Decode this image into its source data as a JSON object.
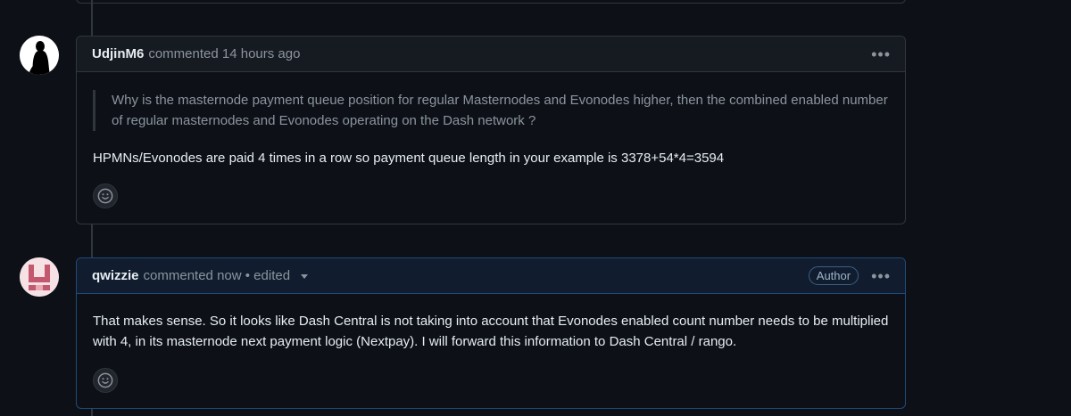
{
  "comments": [
    {
      "username": "UdjinM6",
      "action": "commented",
      "time": "14 hours ago",
      "quote": "Why is the masternode payment queue position for regular Masternodes and Evonodes higher, then the combined enabled number of regular masternodes and Evonodes operating on the Dash network ?",
      "body": "HPMNs/Evonodes are paid 4 times in a row so payment queue length in your example is 3378+54*4=3594"
    },
    {
      "username": "qwizzie",
      "action": "commented",
      "time": "now",
      "edited": "• edited",
      "badge": "Author",
      "body": "That makes sense. So it looks like Dash Central is not taking into account that Evonodes enabled count number needs to be multiplied with 4, in its masternode next payment logic (Nextpay). I will forward this information to Dash Central / rango."
    }
  ],
  "icons": {
    "more": "kebab-horizontal-icon",
    "reaction": "smiley-icon"
  },
  "colors": {
    "background": "#0d1117",
    "header": "#161b22",
    "author_header": "#111d2e",
    "border": "#30363d",
    "author_border": "#1f4a7a"
  }
}
